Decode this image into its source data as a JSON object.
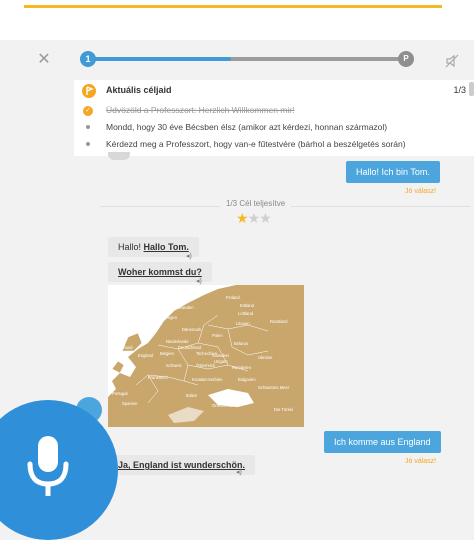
{
  "header": {
    "close_icon": "close-icon",
    "mute_icon": "speaker-off-icon",
    "progress": {
      "value": 0.45,
      "start_label": "1",
      "end_label": "P"
    }
  },
  "goals": {
    "title": "Aktuális céljaid",
    "count": "1/3",
    "items": [
      {
        "text": "Üdvözöld a Professzort: Herzlich Willkommen mir!",
        "done": true
      },
      {
        "text": "Mondd, hogy 30 éve Bécsben élsz (amikor azt kérdezi, honnan származol)",
        "done": false
      },
      {
        "text": "Kérdezd meg a Professzort, hogy van-e fűtestvére (bárhol a beszélgetés során)",
        "done": false
      }
    ]
  },
  "chat": {
    "user_msg_1": "Hallo! Ich bin Tom.",
    "good_1": "Jó válasz!",
    "goal_progress": "1/3 Cél teljesítve",
    "stars": {
      "filled": 1,
      "total": 3
    },
    "bot_msg_1_prefix": "Hallo! ",
    "bot_msg_1_link": "Hallo Tom.",
    "bot_msg_2": "Woher kommst du?",
    "user_msg_2": "Ich komme aus England",
    "good_2": "Jó válasz!",
    "bot_msg_3": "Ja, England ist wunderschön."
  },
  "map": {
    "labels": [
      "Finland",
      "Russland",
      "Schweden",
      "Norwegen",
      "Polen",
      "Ukraine",
      "Frankreich",
      "Spanien",
      "Italien",
      "Deutschland",
      "Rumänien",
      "Die Türkei",
      "Irland",
      "England",
      "Österreich",
      "Ungarn",
      "Belarus",
      "Portugal",
      "Griechenland",
      "Bulgarien",
      "Schwarzes Meer",
      "Estland",
      "Lettland",
      "Litauen",
      "Serbien",
      "Kroatien",
      "Schweiz",
      "Belgien",
      "Niederlande",
      "Dänemark",
      "Tschechien",
      "Slowakei"
    ]
  },
  "mic": {
    "icon": "microphone-icon"
  },
  "colors": {
    "accent": "#f5b921",
    "primary": "#3f9ad6",
    "bubble": "#4ca6dd",
    "mic": "#2f8fd8"
  }
}
